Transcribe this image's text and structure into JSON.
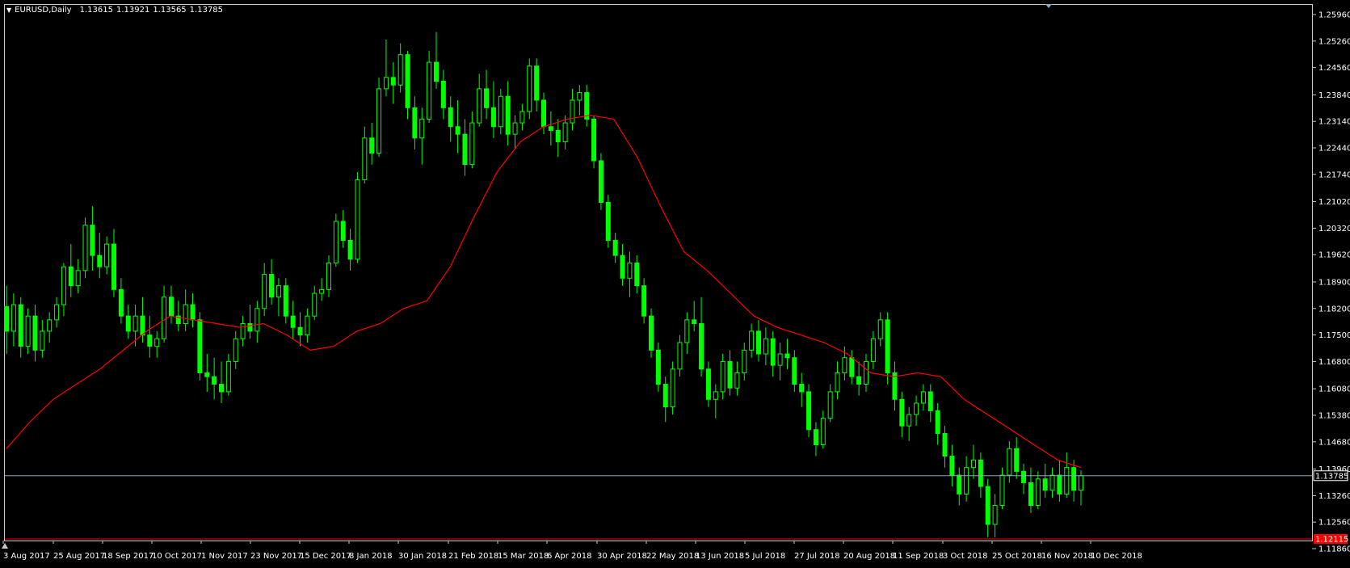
{
  "header": {
    "symbol": "EURUSD,Daily",
    "open": "1.13615",
    "high": "1.13921",
    "low": "1.13565",
    "close": "1.13785"
  },
  "colors": {
    "background": "#000000",
    "candle": "#00ff00",
    "moving_average": "#ff0000",
    "bid_line": "#8ea6c6",
    "ask_line": "#ff0000",
    "axis_text": "#ffffff",
    "frame": "#c8c8c8"
  },
  "current_price_tag": "1.13785",
  "ask_price_tag": "1.12115",
  "chart_data": {
    "type": "candlestick",
    "symbol": "EURUSD",
    "timeframe": "Daily",
    "y_ticks": [
      "1.25960",
      "1.25260",
      "1.24560",
      "1.23840",
      "1.23140",
      "1.22440",
      "1.21740",
      "1.21020",
      "1.20320",
      "1.19620",
      "1.18900",
      "1.18200",
      "1.17500",
      "1.16800",
      "1.16080",
      "1.15380",
      "1.14680",
      "1.13960",
      "1.13260",
      "1.12560",
      "1.11860"
    ],
    "x_ticks": [
      "3 Aug 2017",
      "25 Aug 2017",
      "18 Sep 2017",
      "10 Oct 2017",
      "1 Nov 2017",
      "23 Nov 2017",
      "15 Dec 2017",
      "8 Jan 2018",
      "30 Jan 2018",
      "21 Feb 2018",
      "15 Mar 2018",
      "6 Apr 2018",
      "30 Apr 2018",
      "22 May 2018",
      "13 Jun 2018",
      "5 Jul 2018",
      "27 Jul 2018",
      "20 Aug 2018",
      "11 Sep 2018",
      "3 Oct 2018",
      "25 Oct 2018",
      "16 Nov 2018",
      "10 Dec 2018"
    ],
    "ylim": [
      1.1186,
      1.2596
    ],
    "series": [
      {
        "type": "line",
        "values": [
          1.145,
          1.152,
          1.158,
          1.162,
          1.166,
          1.171,
          1.176,
          1.18,
          1.179,
          1.178,
          1.177,
          1.178,
          1.175,
          1.171,
          1.172,
          1.176,
          1.178,
          1.182,
          1.184,
          1.193,
          1.206,
          1.218,
          1.226,
          1.23,
          1.232,
          1.233,
          1.232,
          1.222,
          1.209,
          1.197,
          1.192,
          1.186,
          1.18,
          1.177,
          1.175,
          1.173,
          1.17,
          1.165,
          1.164,
          1.165,
          1.164,
          1.158,
          1.154,
          1.15,
          1.146,
          1.142,
          1.14
        ]
      }
    ],
    "candles_ohlc": [
      [
        1.1825,
        1.188,
        1.17,
        1.176
      ],
      [
        1.176,
        1.186,
        1.172,
        1.183
      ],
      [
        1.183,
        1.185,
        1.169,
        1.172
      ],
      [
        1.172,
        1.182,
        1.17,
        1.18
      ],
      [
        1.18,
        1.183,
        1.168,
        1.171
      ],
      [
        1.171,
        1.179,
        1.169,
        1.176
      ],
      [
        1.176,
        1.181,
        1.173,
        1.179
      ],
      [
        1.179,
        1.185,
        1.177,
        1.183
      ],
      [
        1.183,
        1.194,
        1.18,
        1.193
      ],
      [
        1.193,
        1.199,
        1.185,
        1.188
      ],
      [
        1.188,
        1.195,
        1.186,
        1.192
      ],
      [
        1.192,
        1.206,
        1.19,
        1.204
      ],
      [
        1.204,
        1.209,
        1.192,
        1.196
      ],
      [
        1.196,
        1.202,
        1.19,
        1.193
      ],
      [
        1.193,
        1.201,
        1.191,
        1.199
      ],
      [
        1.199,
        1.203,
        1.185,
        1.187
      ],
      [
        1.187,
        1.19,
        1.178,
        1.18
      ],
      [
        1.18,
        1.183,
        1.174,
        1.176
      ],
      [
        1.176,
        1.183,
        1.172,
        1.18
      ],
      [
        1.18,
        1.185,
        1.173,
        1.175
      ],
      [
        1.175,
        1.18,
        1.169,
        1.172
      ],
      [
        1.172,
        1.176,
        1.169,
        1.174
      ],
      [
        1.174,
        1.188,
        1.173,
        1.185
      ],
      [
        1.185,
        1.188,
        1.178,
        1.18
      ],
      [
        1.18,
        1.184,
        1.176,
        1.178
      ],
      [
        1.178,
        1.187,
        1.176,
        1.183
      ],
      [
        1.183,
        1.186,
        1.177,
        1.179
      ],
      [
        1.179,
        1.181,
        1.163,
        1.165
      ],
      [
        1.165,
        1.17,
        1.16,
        1.164
      ],
      [
        1.164,
        1.169,
        1.158,
        1.162
      ],
      [
        1.162,
        1.168,
        1.157,
        1.16
      ],
      [
        1.16,
        1.17,
        1.159,
        1.168
      ],
      [
        1.168,
        1.176,
        1.166,
        1.174
      ],
      [
        1.174,
        1.18,
        1.172,
        1.178
      ],
      [
        1.178,
        1.183,
        1.174,
        1.176
      ],
      [
        1.176,
        1.184,
        1.173,
        1.182
      ],
      [
        1.182,
        1.194,
        1.18,
        1.191
      ],
      [
        1.191,
        1.195,
        1.183,
        1.185
      ],
      [
        1.185,
        1.19,
        1.18,
        1.188
      ],
      [
        1.188,
        1.19,
        1.178,
        1.18
      ],
      [
        1.18,
        1.184,
        1.174,
        1.177
      ],
      [
        1.177,
        1.181,
        1.172,
        1.175
      ],
      [
        1.175,
        1.182,
        1.173,
        1.18
      ],
      [
        1.18,
        1.188,
        1.179,
        1.186
      ],
      [
        1.186,
        1.19,
        1.184,
        1.187
      ],
      [
        1.187,
        1.196,
        1.185,
        1.194
      ],
      [
        1.194,
        1.207,
        1.193,
        1.205
      ],
      [
        1.205,
        1.208,
        1.198,
        1.2
      ],
      [
        1.2,
        1.203,
        1.192,
        1.195
      ],
      [
        1.195,
        1.218,
        1.194,
        1.216
      ],
      [
        1.216,
        1.23,
        1.215,
        1.227
      ],
      [
        1.227,
        1.231,
        1.22,
        1.223
      ],
      [
        1.223,
        1.243,
        1.222,
        1.24
      ],
      [
        1.24,
        1.253,
        1.238,
        1.243
      ],
      [
        1.243,
        1.247,
        1.236,
        1.241
      ],
      [
        1.241,
        1.252,
        1.239,
        1.249
      ],
      [
        1.249,
        1.25,
        1.232,
        1.235
      ],
      [
        1.235,
        1.238,
        1.224,
        1.227
      ],
      [
        1.227,
        1.235,
        1.22,
        1.232
      ],
      [
        1.232,
        1.25,
        1.231,
        1.247
      ],
      [
        1.247,
        1.255,
        1.24,
        1.242
      ],
      [
        1.242,
        1.245,
        1.232,
        1.235
      ],
      [
        1.235,
        1.238,
        1.226,
        1.23
      ],
      [
        1.23,
        1.237,
        1.223,
        1.228
      ],
      [
        1.228,
        1.232,
        1.217,
        1.22
      ],
      [
        1.22,
        1.234,
        1.219,
        1.231
      ],
      [
        1.231,
        1.244,
        1.23,
        1.24
      ],
      [
        1.24,
        1.245,
        1.232,
        1.235
      ],
      [
        1.235,
        1.242,
        1.227,
        1.23
      ],
      [
        1.23,
        1.24,
        1.228,
        1.238
      ],
      [
        1.238,
        1.242,
        1.225,
        1.228
      ],
      [
        1.228,
        1.233,
        1.224,
        1.231
      ],
      [
        1.231,
        1.236,
        1.229,
        1.234
      ],
      [
        1.234,
        1.248,
        1.232,
        1.246
      ],
      [
        1.246,
        1.248,
        1.234,
        1.237
      ],
      [
        1.237,
        1.239,
        1.228,
        1.23
      ],
      [
        1.23,
        1.234,
        1.225,
        1.229
      ],
      [
        1.229,
        1.232,
        1.222,
        1.226
      ],
      [
        1.226,
        1.233,
        1.224,
        1.231
      ],
      [
        1.231,
        1.24,
        1.229,
        1.237
      ],
      [
        1.237,
        1.241,
        1.233,
        1.239
      ],
      [
        1.239,
        1.241,
        1.23,
        1.232
      ],
      [
        1.232,
        1.233,
        1.219,
        1.221
      ],
      [
        1.221,
        1.223,
        1.208,
        1.21
      ],
      [
        1.21,
        1.212,
        1.198,
        1.2
      ],
      [
        1.2,
        1.202,
        1.194,
        1.196
      ],
      [
        1.196,
        1.199,
        1.188,
        1.19
      ],
      [
        1.19,
        1.197,
        1.185,
        1.194
      ],
      [
        1.194,
        1.196,
        1.186,
        1.188
      ],
      [
        1.188,
        1.19,
        1.178,
        1.18
      ],
      [
        1.18,
        1.182,
        1.169,
        1.171
      ],
      [
        1.171,
        1.173,
        1.16,
        1.162
      ],
      [
        1.162,
        1.164,
        1.152,
        1.156
      ],
      [
        1.156,
        1.168,
        1.154,
        1.166
      ],
      [
        1.166,
        1.175,
        1.164,
        1.173
      ],
      [
        1.173,
        1.181,
        1.17,
        1.179
      ],
      [
        1.179,
        1.184,
        1.176,
        1.178
      ],
      [
        1.178,
        1.185,
        1.164,
        1.166
      ],
      [
        1.166,
        1.168,
        1.156,
        1.158
      ],
      [
        1.158,
        1.162,
        1.153,
        1.16
      ],
      [
        1.16,
        1.17,
        1.158,
        1.168
      ],
      [
        1.168,
        1.171,
        1.159,
        1.161
      ],
      [
        1.161,
        1.168,
        1.159,
        1.165
      ],
      [
        1.165,
        1.173,
        1.163,
        1.171
      ],
      [
        1.171,
        1.178,
        1.169,
        1.176
      ],
      [
        1.176,
        1.179,
        1.168,
        1.17
      ],
      [
        1.17,
        1.177,
        1.167,
        1.174
      ],
      [
        1.174,
        1.176,
        1.164,
        1.167
      ],
      [
        1.167,
        1.173,
        1.163,
        1.17
      ],
      [
        1.17,
        1.174,
        1.166,
        1.169
      ],
      [
        1.169,
        1.171,
        1.16,
        1.162
      ],
      [
        1.162,
        1.165,
        1.156,
        1.16
      ],
      [
        1.16,
        1.162,
        1.148,
        1.15
      ],
      [
        1.15,
        1.152,
        1.143,
        1.146
      ],
      [
        1.146,
        1.155,
        1.145,
        1.153
      ],
      [
        1.153,
        1.162,
        1.152,
        1.16
      ],
      [
        1.16,
        1.168,
        1.158,
        1.165
      ],
      [
        1.165,
        1.172,
        1.163,
        1.169
      ],
      [
        1.169,
        1.171,
        1.162,
        1.164
      ],
      [
        1.164,
        1.168,
        1.159,
        1.162
      ],
      [
        1.162,
        1.17,
        1.16,
        1.168
      ],
      [
        1.168,
        1.176,
        1.166,
        1.174
      ],
      [
        1.174,
        1.181,
        1.172,
        1.179
      ],
      [
        1.179,
        1.181,
        1.162,
        1.165
      ],
      [
        1.165,
        1.168,
        1.155,
        1.158
      ],
      [
        1.158,
        1.16,
        1.148,
        1.151
      ],
      [
        1.151,
        1.156,
        1.147,
        1.154
      ],
      [
        1.154,
        1.159,
        1.151,
        1.157
      ],
      [
        1.157,
        1.162,
        1.155,
        1.16
      ],
      [
        1.16,
        1.162,
        1.152,
        1.155
      ],
      [
        1.155,
        1.157,
        1.146,
        1.149
      ],
      [
        1.149,
        1.151,
        1.14,
        1.143
      ],
      [
        1.143,
        1.146,
        1.135,
        1.138
      ],
      [
        1.138,
        1.14,
        1.13,
        1.133
      ],
      [
        1.133,
        1.143,
        1.131,
        1.14
      ],
      [
        1.14,
        1.146,
        1.137,
        1.142
      ],
      [
        1.142,
        1.144,
        1.132,
        1.135
      ],
      [
        1.135,
        1.137,
        1.1216,
        1.125
      ],
      [
        1.125,
        1.133,
        1.1216,
        1.13
      ],
      [
        1.13,
        1.14,
        1.129,
        1.138
      ],
      [
        1.138,
        1.147,
        1.136,
        1.145
      ],
      [
        1.145,
        1.148,
        1.137,
        1.139
      ],
      [
        1.139,
        1.141,
        1.133,
        1.136
      ],
      [
        1.136,
        1.14,
        1.128,
        1.13
      ],
      [
        1.13,
        1.139,
        1.129,
        1.137
      ],
      [
        1.137,
        1.141,
        1.132,
        1.134
      ],
      [
        1.134,
        1.14,
        1.132,
        1.138
      ],
      [
        1.138,
        1.142,
        1.131,
        1.133
      ],
      [
        1.133,
        1.144,
        1.132,
        1.14
      ],
      [
        1.14,
        1.142,
        1.131,
        1.134
      ],
      [
        1.134,
        1.1392,
        1.13,
        1.13785
      ]
    ]
  }
}
